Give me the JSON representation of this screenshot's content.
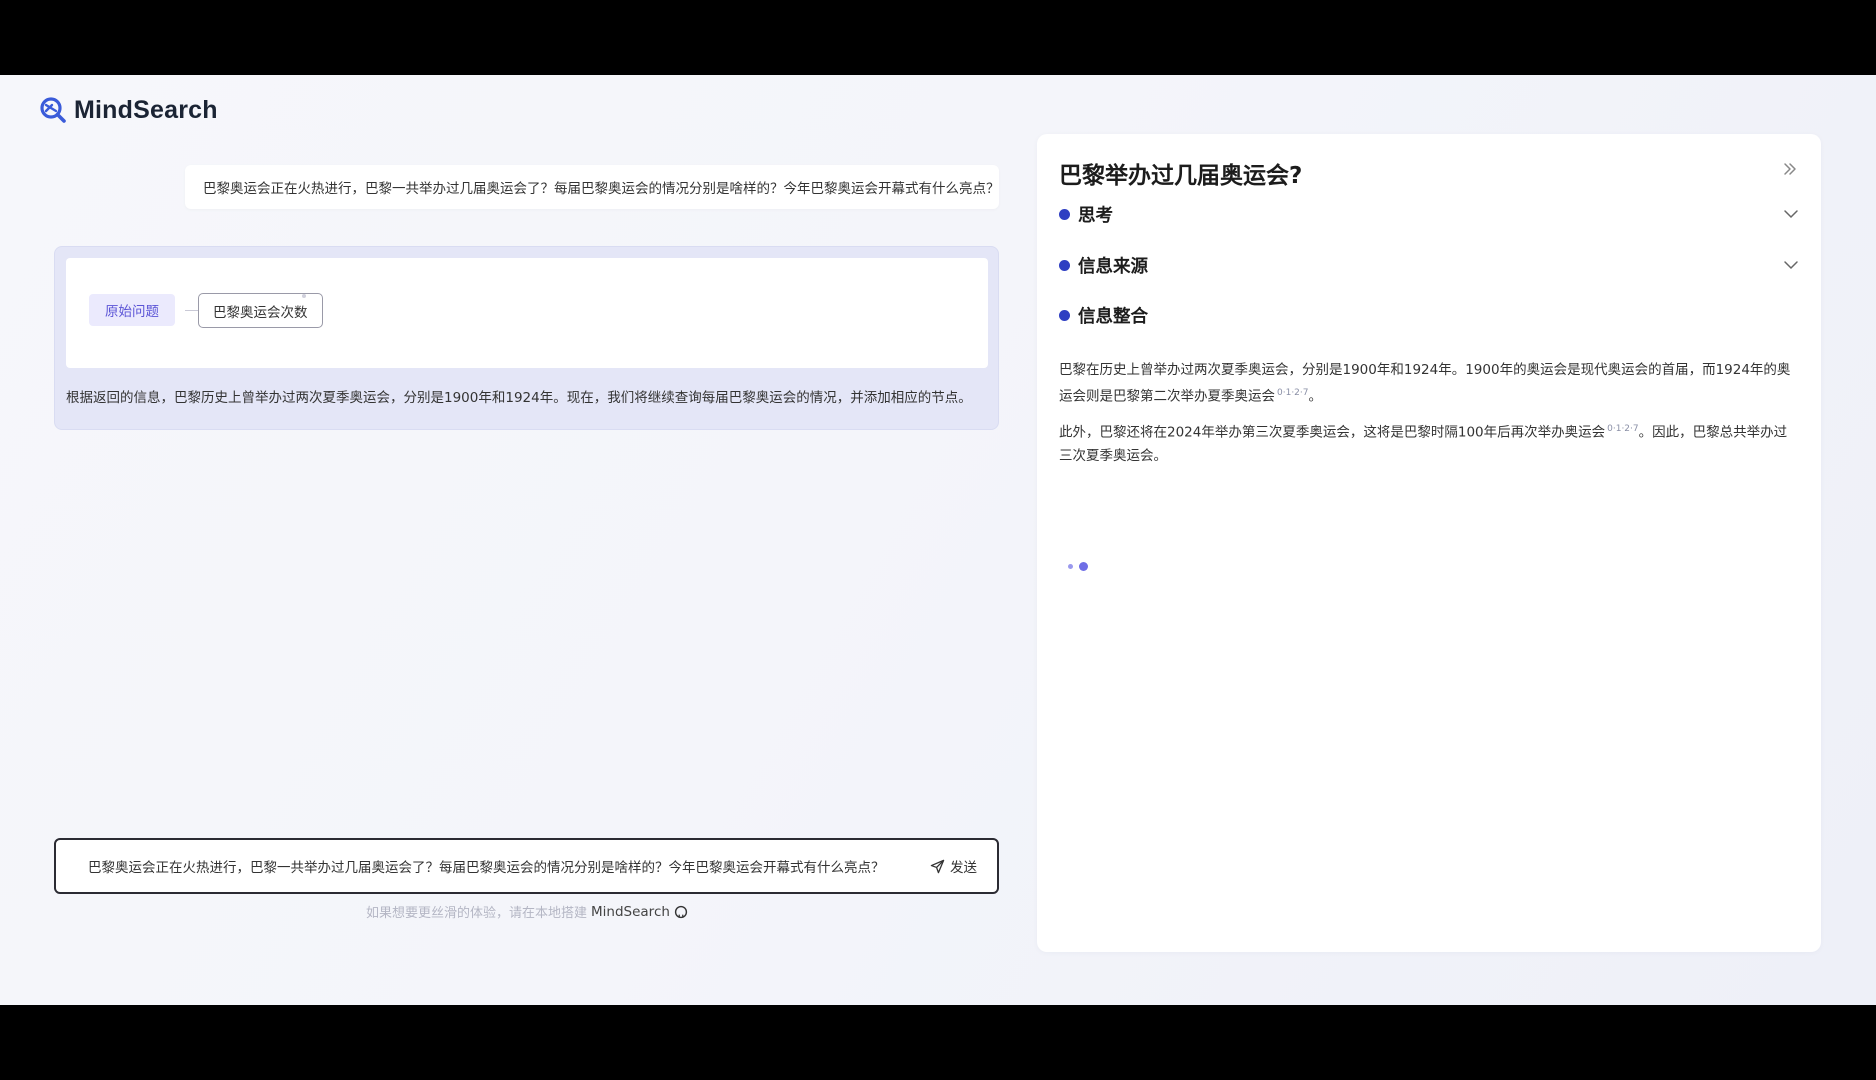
{
  "app": {
    "name": "MindSearch"
  },
  "chat": {
    "user_question": "巴黎奥运会正在火热进行，巴黎一共举办过几届奥运会了？每届巴黎奥运会的情况分别是啥样的？今年巴黎奥运会开幕式有什么亮点？",
    "graph": {
      "root_label": "原始问题",
      "child_label": "巴黎奥运会次数"
    },
    "answer_text": "根据返回的信息，巴黎历史上曾举办过两次夏季奥运会，分别是1900年和1924年。现在，我们将继续查询每届巴黎奥运会的情况，并添加相应的节点。"
  },
  "input": {
    "value": "巴黎奥运会正在火热进行，巴黎一共举办过几届奥运会了？每届巴黎奥运会的情况分别是啥样的？今年巴黎奥运会开幕式有什么亮点？",
    "send_label": "发送"
  },
  "footer": {
    "hint": "如果想要更丝滑的体验，请在本地搭建",
    "link": "MindSearch"
  },
  "panel": {
    "title": "巴黎举办过几届奥运会?",
    "sections": {
      "thinking": "思考",
      "sources": "信息来源",
      "integration": "信息整合"
    },
    "para1_text": "巴黎在历史上曾举办过两次夏季奥运会，分别是1900年和1924年。1900年的奥运会是现代奥运会的首届，而1924年的奥运会则是巴黎第二次举办夏季奥运会",
    "para1_refs": "0·1·2·7",
    "para1_end": "。",
    "para2_text": "此外，巴黎还将在2024年举办第三次夏季奥运会，这将是巴黎时隔100年后再次举办奥运会",
    "para2_refs": "0·1·2·7",
    "para2_end": "。因此，巴黎总共举办过三次夏季奥运会。"
  },
  "colors": {
    "accent": "#2f3fc2",
    "root_node_bg": "#ebeafd",
    "root_node_text": "#5b54d6",
    "answer_box_bg": "#e4e6f7"
  },
  "icons": [
    "mindsearch-logo-icon",
    "send-icon",
    "github-icon",
    "double-chevron-right-icon",
    "chevron-down-icon"
  ]
}
